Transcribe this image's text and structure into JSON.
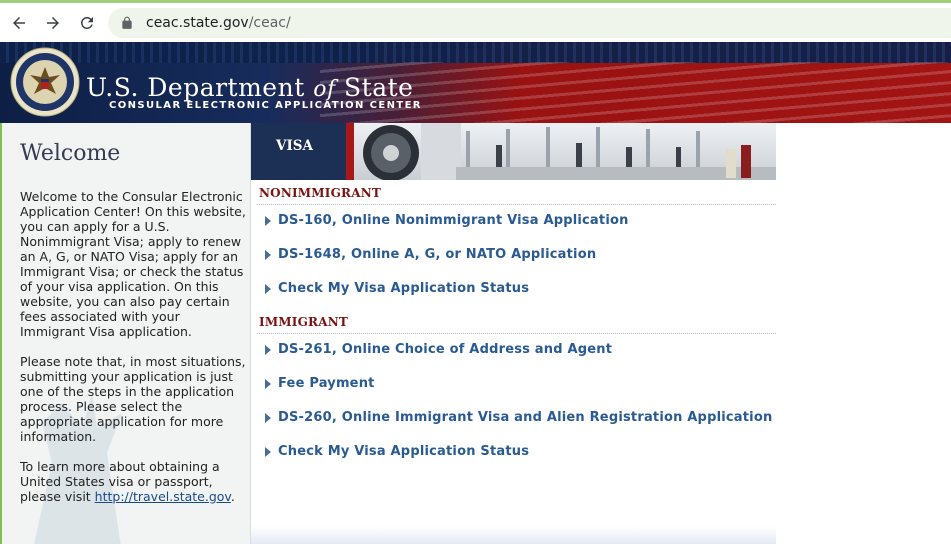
{
  "browser": {
    "url_host": "ceac.state.gov",
    "url_path": "/ceac/"
  },
  "banner": {
    "title_prefix": "U.S. Department",
    "title_of": "of",
    "title_suffix": "State",
    "subtitle": "CONSULAR ELECTRONIC APPLICATION CENTER"
  },
  "sidebar": {
    "title": "Welcome",
    "paragraph1": "Welcome to the Consular Electronic Application Center! On this website, you can apply for a U.S. Nonimmigrant Visa; apply to renew an A, G, or NATO Visa; apply for an Immigrant Visa; or check the status of your visa application. On this website, you can also pay certain fees associated with your Immigrant Visa application.",
    "paragraph2": "Please note that, in most situations, submitting your application is just one of the steps in the application process. Please select the appropriate application for more information.",
    "paragraph3_prefix": "To learn more about obtaining a United States visa or passport, please visit ",
    "link_text": "http://travel.state.gov",
    "paragraph3_suffix": "."
  },
  "main": {
    "header_label": "VISA",
    "nonimmigrant": {
      "heading": "NONIMMIGRANT",
      "links": [
        "DS-160, Online Nonimmigrant Visa Application",
        "DS-1648, Online A, G, or NATO Application",
        "Check My Visa Application Status"
      ]
    },
    "immigrant": {
      "heading": "IMMIGRANT",
      "links": [
        "DS-261, Online Choice of Address and Agent",
        "Fee Payment",
        "DS-260, Online Immigrant Visa and Alien Registration Application",
        "Check My Visa Application Status"
      ]
    }
  },
  "colors": {
    "link": "#2a5a92",
    "section_heading": "#7a1212",
    "banner_navy": "#172c5c",
    "banner_red": "#a31414"
  }
}
